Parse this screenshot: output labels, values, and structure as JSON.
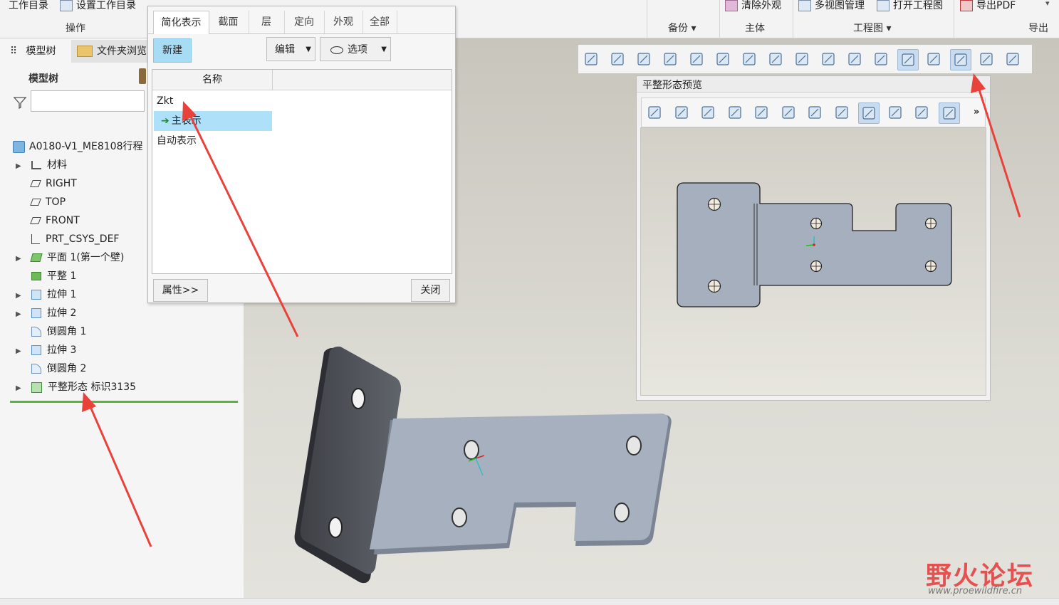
{
  "ribbon": {
    "work_dir": "工作目录",
    "set_work_dir": "设置工作目录",
    "group_operation": "操作",
    "clear_appearance": "清除外观",
    "multi_view_manager": "多视图管理",
    "open_drawing": "打开工程图",
    "export_pdf": "导出PDF",
    "group_backup": "备份",
    "group_main": "主体",
    "group_drawing": "工程图",
    "group_export": "导出"
  },
  "left_panel": {
    "tab_model_tree": "模型树",
    "tab_folder_browser": "文件夹浏览",
    "model_tree_header": "模型树",
    "filter_placeholder": "",
    "root": "A0180-V1_ME8108行程",
    "items": [
      {
        "label": "材料",
        "expandable": true,
        "icon": "material-icon"
      },
      {
        "label": "RIGHT",
        "expandable": false,
        "icon": "datum-plane-icon"
      },
      {
        "label": "TOP",
        "expandable": false,
        "icon": "datum-plane-icon"
      },
      {
        "label": "FRONT",
        "expandable": false,
        "icon": "datum-plane-icon"
      },
      {
        "label": "PRT_CSYS_DEF",
        "expandable": false,
        "icon": "csys-icon"
      },
      {
        "label": "平面 1(第一个壁)",
        "expandable": true,
        "icon": "planar-wall-icon"
      },
      {
        "label": "平整 1",
        "expandable": false,
        "icon": "flat-wall-icon"
      },
      {
        "label": "拉伸 1",
        "expandable": true,
        "icon": "extrude-icon"
      },
      {
        "label": "拉伸 2",
        "expandable": true,
        "icon": "extrude-icon"
      },
      {
        "label": "倒圆角 1",
        "expandable": false,
        "icon": "round-icon"
      },
      {
        "label": "拉伸 3",
        "expandable": true,
        "icon": "extrude-icon"
      },
      {
        "label": "倒圆角 2",
        "expandable": false,
        "icon": "round-icon"
      },
      {
        "label": "平整形态 标识3135",
        "expandable": true,
        "icon": "flat-pattern-icon"
      }
    ]
  },
  "dialog": {
    "tabs": [
      "简化表示",
      "截面",
      "层",
      "定向",
      "外观",
      "全部"
    ],
    "new_button": "新建",
    "edit_button": "编辑",
    "options_button": "选项",
    "column_name": "名称",
    "rows": [
      "Zkt",
      "主表示",
      "自动表示"
    ],
    "properties_button": "属性>>",
    "close_button": "关闭"
  },
  "preview": {
    "title": "平整形态预览"
  },
  "watermark": {
    "forum_name": "野火论坛",
    "url": "www.proewildfire.cn"
  },
  "colors": {
    "accent_blue": "#a8dcf5",
    "selected_row": "#aee0fa",
    "annotation_red": "#e8423b",
    "part_face": "#a5afbd",
    "part_dark": "#5e6166",
    "tree_separator": "#59b53a"
  }
}
